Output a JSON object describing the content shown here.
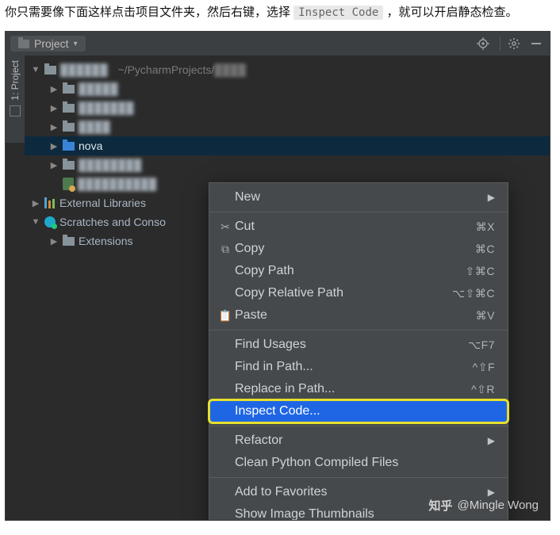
{
  "caption": {
    "prefix": "你只需要像下面这样点击项目文件夹，然后右键，选择",
    "code": "Inspect Code",
    "suffix": "，就可以开启静态检查。"
  },
  "toolbar": {
    "title": "Project"
  },
  "gutter": {
    "label": "1: Project"
  },
  "tree": {
    "root_path": "~/PycharmProjects/",
    "nova": "nova",
    "ext_libs": "External Libraries",
    "scratches": "Scratches and Conso",
    "extensions": "Extensions"
  },
  "menu": {
    "new": "New",
    "cut": "Cut",
    "cut_sc": "⌘X",
    "copy": "Copy",
    "copy_sc": "⌘C",
    "copy_path": "Copy Path",
    "copy_path_sc": "⇧⌘C",
    "copy_rel": "Copy Relative Path",
    "copy_rel_sc": "⌥⇧⌘C",
    "paste": "Paste",
    "paste_sc": "⌘V",
    "find_usages": "Find Usages",
    "find_usages_sc": "⌥F7",
    "find_in_path": "Find in Path...",
    "find_in_path_sc": "^⇧F",
    "replace_in_path": "Replace in Path...",
    "replace_in_path_sc": "^⇧R",
    "inspect": "Inspect Code...",
    "refactor": "Refactor",
    "clean_py": "Clean Python Compiled Files",
    "add_fav": "Add to Favorites",
    "show_thumbs": "Show Image Thumbnails"
  },
  "watermark": {
    "brand": "知乎",
    "author": "@Mingle Wong"
  }
}
